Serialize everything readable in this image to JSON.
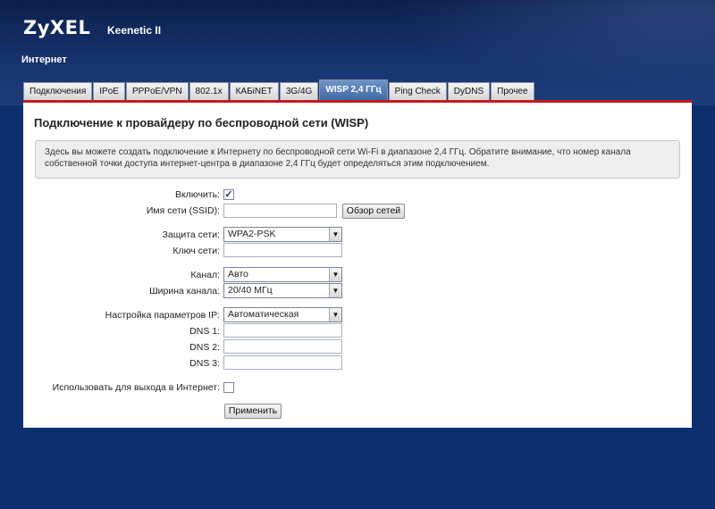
{
  "header": {
    "brand": "ZyXEL",
    "model": "Keenetic II",
    "section": "Интернет"
  },
  "tabs": [
    {
      "label": "Подключения",
      "active": false
    },
    {
      "label": "IPoE",
      "active": false
    },
    {
      "label": "PPPoE/VPN",
      "active": false
    },
    {
      "label": "802.1x",
      "active": false
    },
    {
      "label": "КАБiNET",
      "active": false
    },
    {
      "label": "3G/4G",
      "active": false
    },
    {
      "label": "WISP 2,4 ГГц",
      "active": true
    },
    {
      "label": "Ping Check",
      "active": false
    },
    {
      "label": "DyDNS",
      "active": false
    },
    {
      "label": "Прочее",
      "active": false
    }
  ],
  "main": {
    "title": "Подключение к провайдеру по беспроводной сети (WISP)",
    "info": "Здесь вы можете создать подключение к Интернету по беспроводной сети Wi-Fi в диапазоне 2,4 ГГц. Обратите внимание, что номер канала собственной точки доступа интернет-центра в диапазоне 2,4 ГГц будет определяться этим подключением."
  },
  "form": {
    "enable_label": "Включить:",
    "enable_checked": true,
    "ssid_label": "Имя сети (SSID):",
    "ssid_value": "",
    "scan_button": "Обзор сетей",
    "security_label": "Защита сети:",
    "security_value": "WPA2-PSK",
    "key_label": "Ключ сети:",
    "key_value": "",
    "channel_label": "Канал:",
    "channel_value": "Авто",
    "width_label": "Ширина канала:",
    "width_value": "20/40 МГц",
    "ip_label": "Настройка параметров IP:",
    "ip_value": "Автоматическая",
    "dns1_label": "DNS 1:",
    "dns2_label": "DNS 2:",
    "dns3_label": "DNS 3:",
    "use_internet_label": "Использовать для выхода в Интернет:",
    "use_internet_checked": false,
    "apply_button": "Применить"
  },
  "colors": {
    "accent": "#c81b1b",
    "active_tab": "#3f6aa8",
    "background": "#0d2f6e"
  }
}
